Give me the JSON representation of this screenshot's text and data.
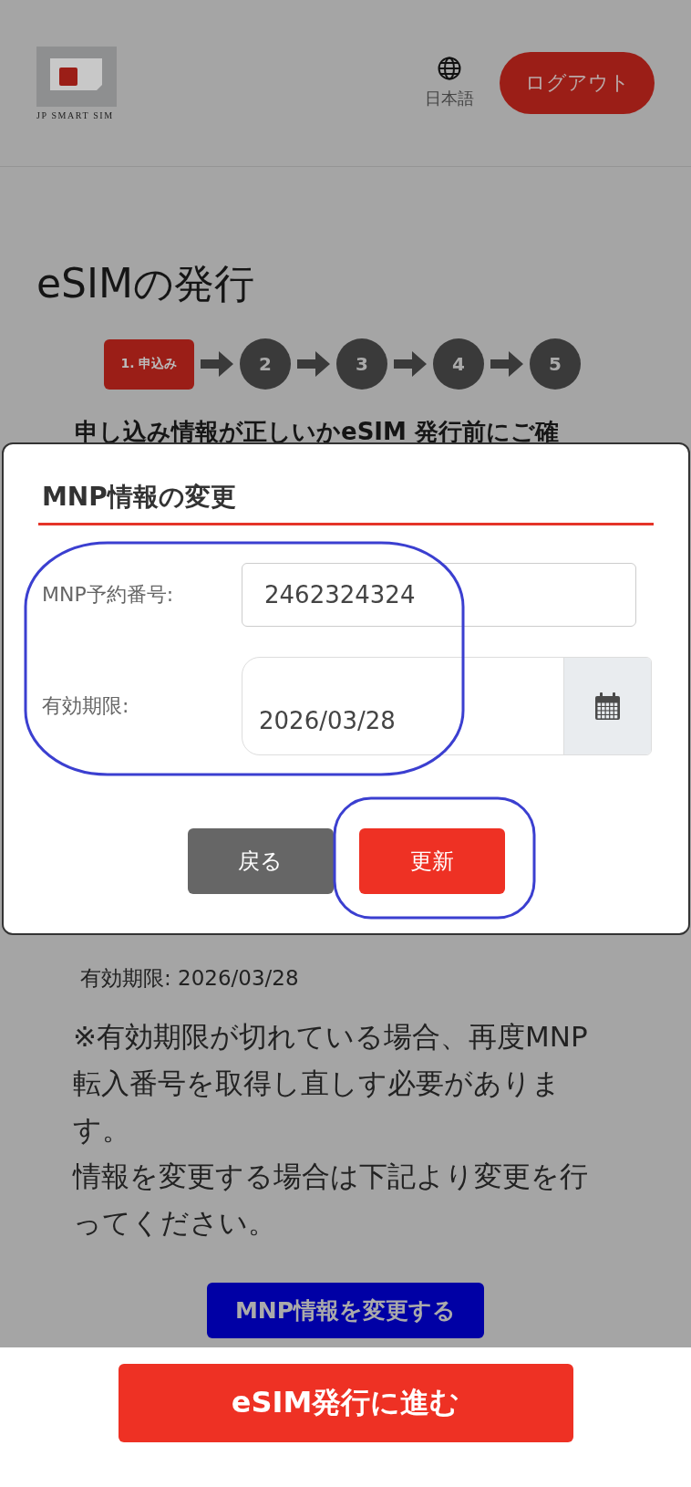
{
  "header": {
    "logo_text": "JP SMART SIM",
    "language": "日本語",
    "logout": "ログアウト"
  },
  "page": {
    "title": "eSIMの発行",
    "steps": [
      {
        "label": "1. 申込み",
        "selected": true
      },
      {
        "label": "2",
        "selected": false
      },
      {
        "label": "3",
        "selected": false
      },
      {
        "label": "4",
        "selected": false
      },
      {
        "label": "5",
        "selected": false
      }
    ],
    "heading": "申し込み情報が正しいかeSIM 発行前にご確",
    "summary": [
      "有効期限: 2026/03/28"
    ],
    "notes": [
      "※有効期限が切れている場合、再度MNP転入番号を取得し直しす必要があります。",
      "情報を変更する場合は下記より変更を行ってください。"
    ],
    "change_button": "MNP情報を変更する"
  },
  "modal": {
    "title": "MNP情報の変更",
    "fields": [
      {
        "label": "MNP予約番号:",
        "value": "2462324324",
        "kind": "text"
      },
      {
        "label": "有効期限:",
        "value": "2026/03/28",
        "kind": "date"
      }
    ],
    "buttons": [
      {
        "label": "戻る",
        "kind": "secondary"
      },
      {
        "label": "更新",
        "kind": "primary"
      }
    ]
  },
  "footer": {
    "button": "eSIM発行に進む"
  }
}
